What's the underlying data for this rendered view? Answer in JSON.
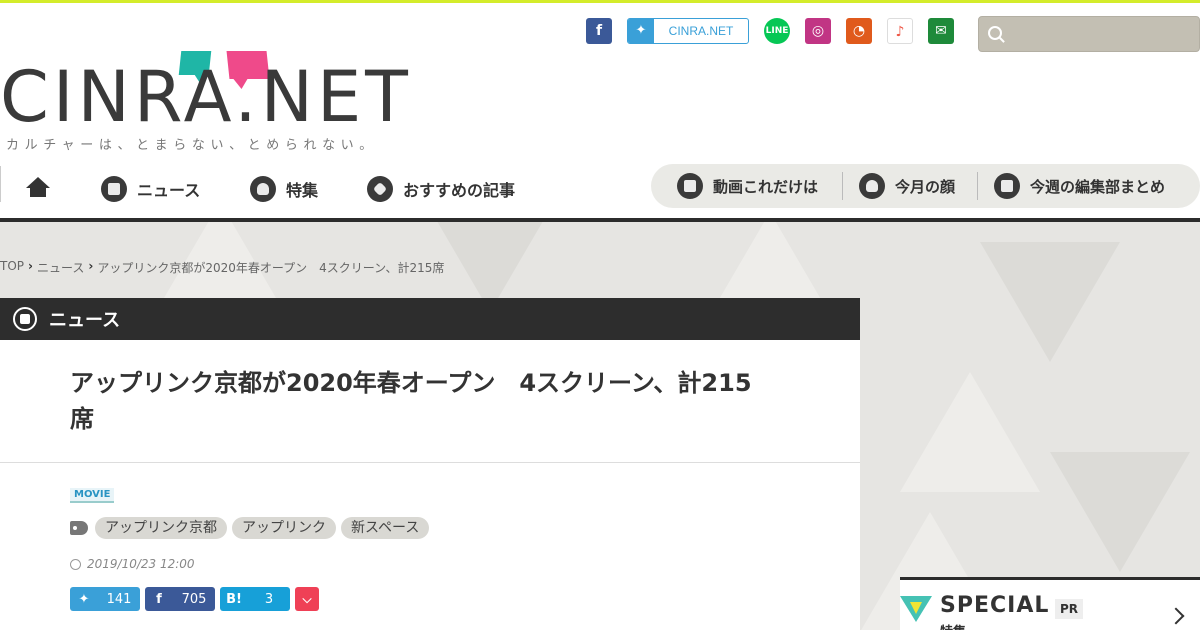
{
  "header": {
    "logo_text": "CINRA.NET",
    "tagline": "カルチャーは、とまらない、とめられない。",
    "twitter_label": "CINRA.NET",
    "search_placeholder": "",
    "social_icons": [
      "facebook-icon",
      "twitter-icon",
      "line-icon",
      "instagram-icon",
      "rss-icon",
      "apple-music-icon",
      "mail-icon"
    ]
  },
  "nav": {
    "items": [
      {
        "label": "ニュース"
      },
      {
        "label": "特集"
      },
      {
        "label": "おすすめの記事"
      }
    ],
    "pill_items": [
      {
        "label": "動画これだけは"
      },
      {
        "label": "今月の顔"
      },
      {
        "label": "今週の編集部まとめ"
      }
    ]
  },
  "breadcrumb": {
    "items": [
      "TOP",
      "ニュース",
      "アップリンク京都が2020年春オープン　4スクリーン、計215席"
    ]
  },
  "article": {
    "section_label": "ニュース",
    "title": "アップリンク京都が2020年春オープン　4スクリーン、計215席",
    "category": "MOVIE",
    "tags": [
      "アップリンク京都",
      "アップリンク",
      "新スペース"
    ],
    "date": "2019/10/23 12:00",
    "shares": {
      "twitter_count": "141",
      "facebook_count": "705",
      "hatena_label": "B!",
      "hatena_count": "3"
    }
  },
  "special": {
    "title": "SPECIAL",
    "pr": "PR",
    "subtitle": "特集"
  },
  "colors": {
    "accent_top": "#d4ec2a",
    "teal": "#1fb6a6",
    "pink": "#ef4a8a",
    "twitter": "#3aa0d8",
    "facebook": "#3b5998",
    "hatena": "#17a0d8",
    "pocket": "#ef4056"
  }
}
